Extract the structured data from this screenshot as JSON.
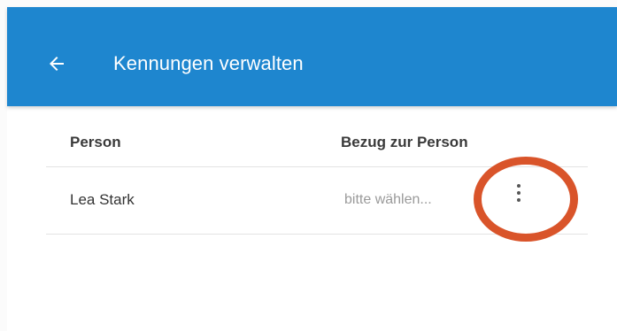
{
  "appbar": {
    "title": "Kennungen verwalten",
    "back_icon": "arrow-left-icon",
    "color": "#1e86cf"
  },
  "table": {
    "headers": {
      "person": "Person",
      "bezug": "Bezug zur Person"
    },
    "rows": [
      {
        "name": "Lea Stark",
        "bezug_placeholder": "bitte wählen...",
        "menu_icon": "more-vertical-icon"
      }
    ]
  },
  "annotation": {
    "ring_color": "#d9542a"
  }
}
